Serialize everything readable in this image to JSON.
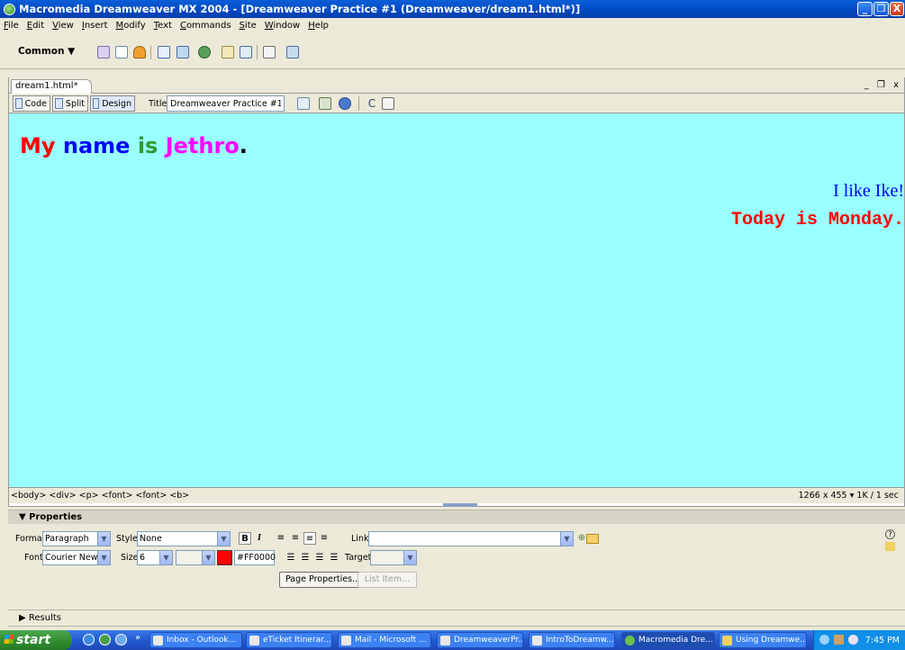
{
  "window": {
    "title": "Macromedia Dreamweaver MX 2004 - [Dreamweaver Practice #1 (Dreamweaver/dream1.html*)]",
    "controls": [
      "_",
      "❐",
      "X"
    ]
  },
  "menubar": {
    "items": [
      "File",
      "Edit",
      "View",
      "Insert",
      "Modify",
      "Text",
      "Commands",
      "Site",
      "Window",
      "Help"
    ]
  },
  "insertbar": {
    "category": "Common ▼"
  },
  "document": {
    "tab": "dream1.html*",
    "window_controls": "_ ❐ x",
    "views": [
      "Code",
      "Split",
      "Design"
    ],
    "title_label": "Title:",
    "title_value": "Dreamweaver Practice #1"
  },
  "canvas": {
    "background": "#99FFFF",
    "paragraph1": [
      {
        "text": "My ",
        "color": "#FF0000"
      },
      {
        "text": "name ",
        "color": "#0000FF"
      },
      {
        "text": "is ",
        "color": "#339933"
      },
      {
        "text": "Jethro",
        "color": "#FF00FF"
      },
      {
        "text": ".",
        "color": "#000000"
      }
    ],
    "line2": "I like Ike!",
    "line3": "Today is Monday."
  },
  "statusbar": {
    "tag_selector": "<body> <div> <p> <font> <font> <b>",
    "window_info": "1266 x 455 ▾ 1K / 1 sec"
  },
  "properties": {
    "header": "▼ Properties",
    "format_label": "Format",
    "format_value": "Paragraph",
    "style_label": "Style",
    "style_value": "None",
    "bold": "B",
    "italic": "I",
    "link_label": "Link",
    "link_value": "",
    "font_label": "Font",
    "font_value": "Courier New, (",
    "size_label": "Size",
    "size_value": "6",
    "color_value": "#FF0000",
    "target_label": "Target",
    "page_properties": "Page Properties...",
    "list_item": "List Item..."
  },
  "results": {
    "label": "▶ Results"
  },
  "taskbar": {
    "start": "start",
    "tasks": [
      "Inbox - Outlook...",
      "eTicket Itinerar...",
      "Mail - Microsoft ...",
      "DreamweaverPr...",
      "IntroToDreamw...",
      "Macromedia Dre...",
      "Using Dreamwe..."
    ],
    "clock": "7:45 PM"
  }
}
